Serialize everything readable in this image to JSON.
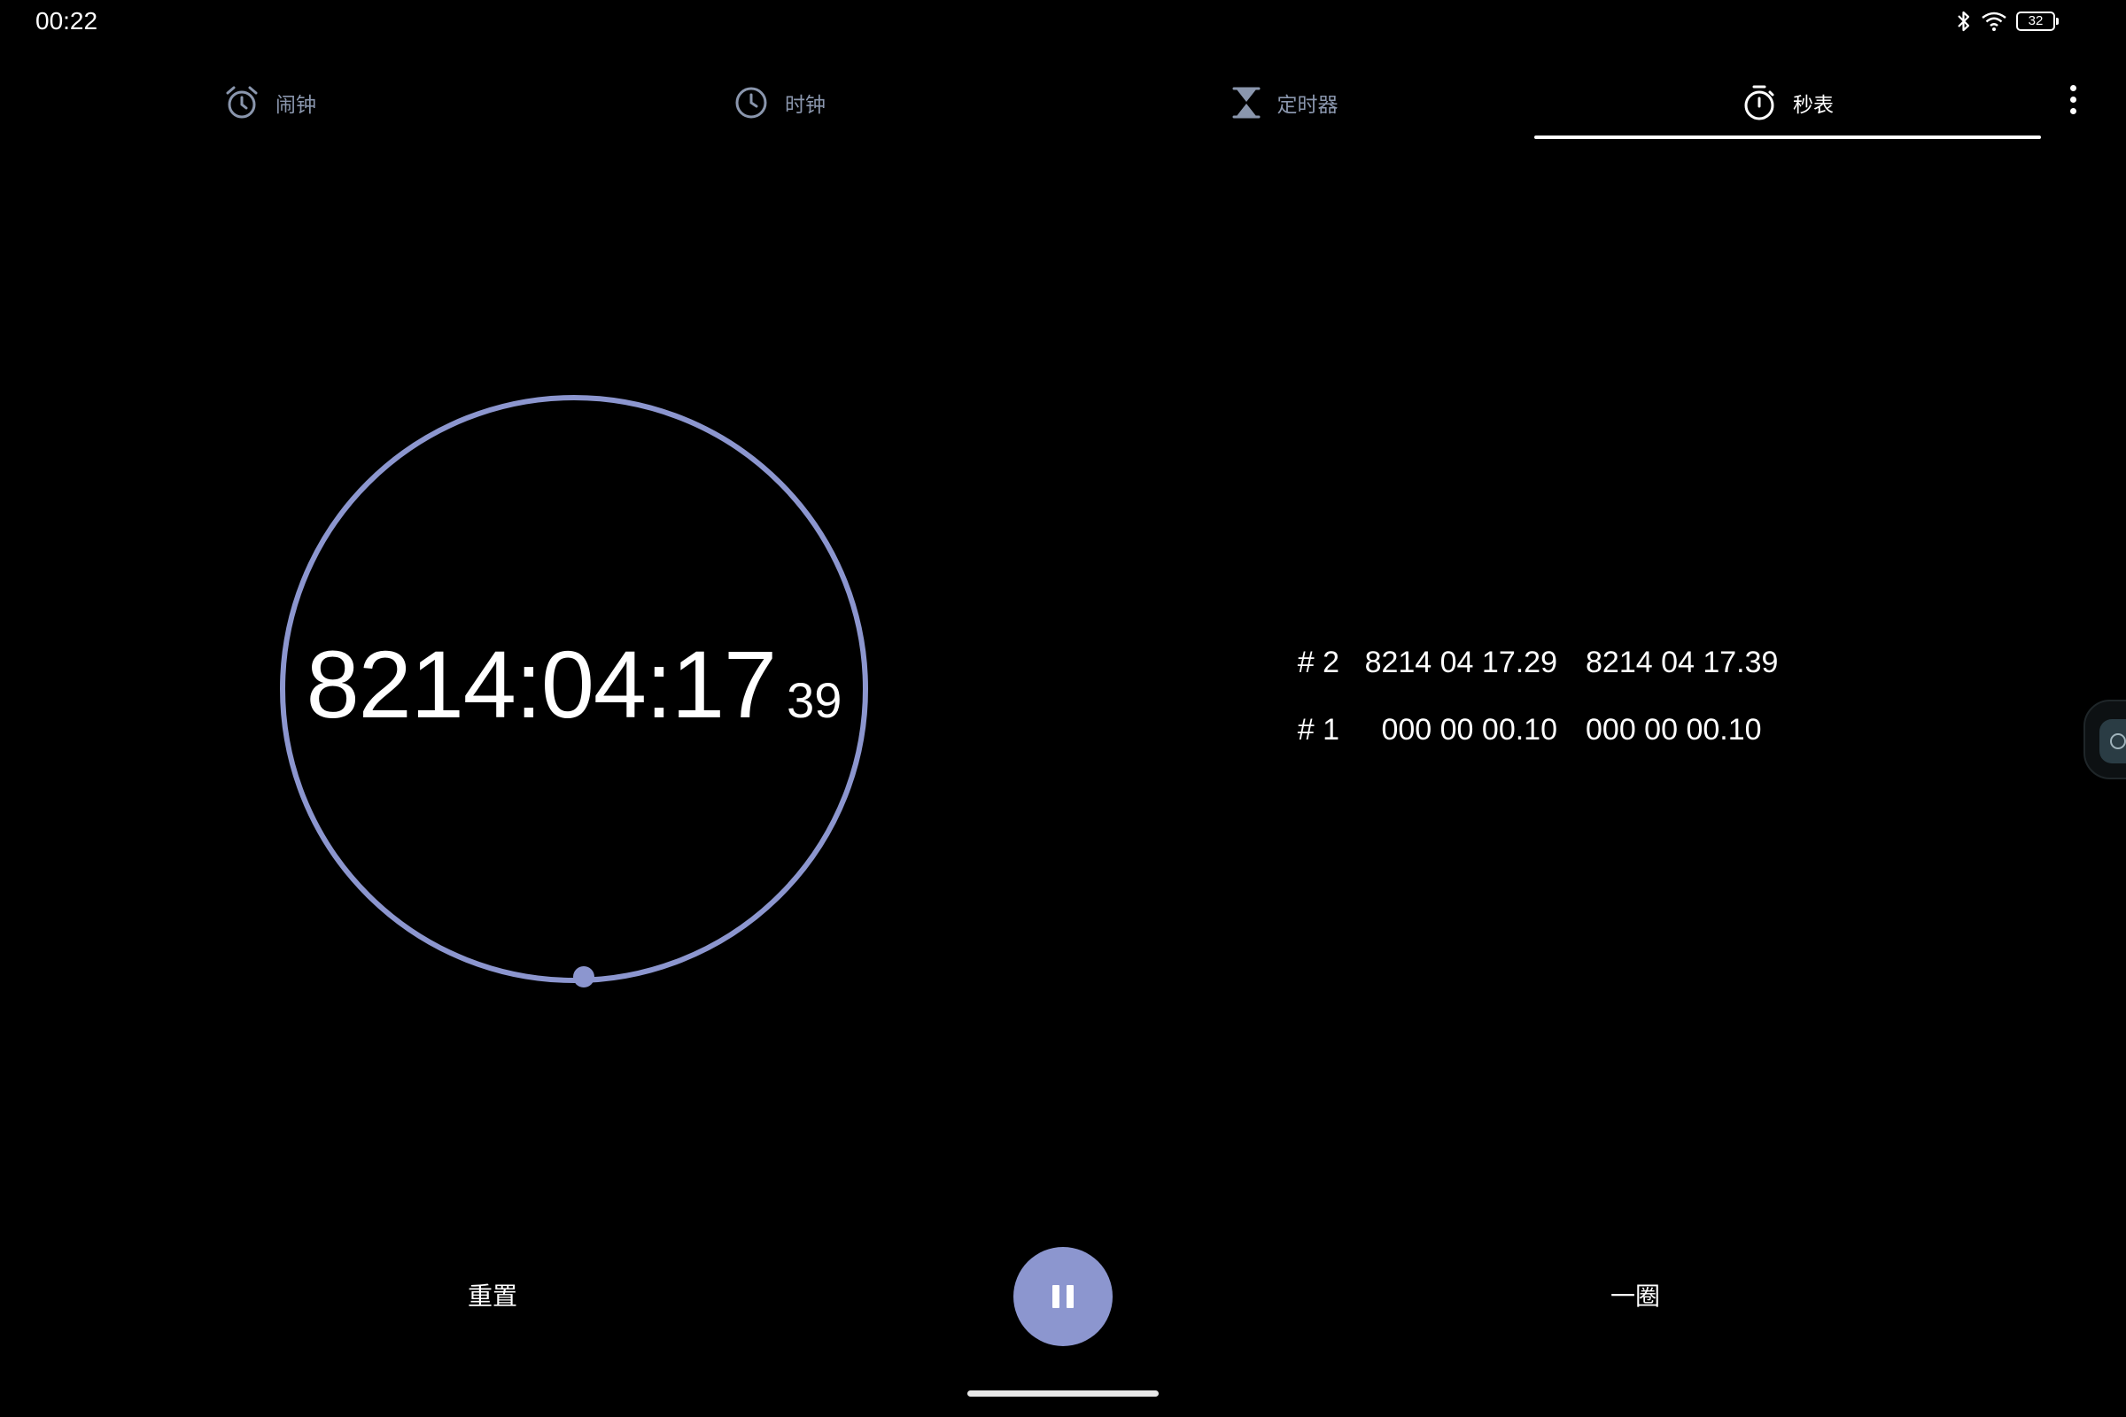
{
  "status_bar": {
    "time": "00:22",
    "battery_level": "32",
    "icons": [
      "bluetooth-icon",
      "wifi-icon",
      "battery-icon"
    ]
  },
  "tabs": [
    {
      "label": "闹钟",
      "icon": "alarm-icon",
      "active": false
    },
    {
      "label": "时钟",
      "icon": "clock-icon",
      "active": false
    },
    {
      "label": "定时器",
      "icon": "hourglass-icon",
      "active": false
    },
    {
      "label": "秒表",
      "icon": "stopwatch-icon",
      "active": true
    }
  ],
  "stopwatch": {
    "elapsed_main": "8214:04:17",
    "elapsed_hundredths": "39",
    "accent_color": "#8c96cf"
  },
  "laps": [
    {
      "number": "# 2",
      "lap_time": "8214 04 17.29",
      "total_time": "8214 04 17.39"
    },
    {
      "number": "# 1",
      "lap_time": "000 00 00.10",
      "total_time": "000 00 00.10"
    }
  ],
  "controls": {
    "reset_label": "重置",
    "lap_label": "一圈",
    "pause_icon": "pause-icon"
  }
}
